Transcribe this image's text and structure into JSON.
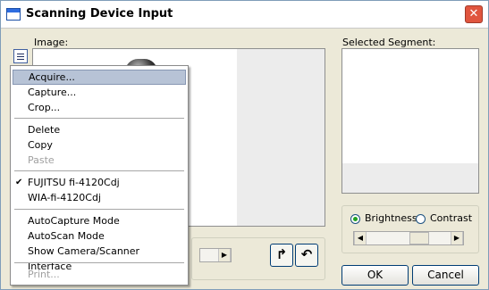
{
  "window": {
    "title": "Scanning Device Input",
    "close_glyph": "✕"
  },
  "labels": {
    "image": "Image:",
    "selected_segment": "Selected Segment:"
  },
  "adjust": {
    "brightness": "Brightness",
    "contrast": "Contrast",
    "selected": "brightness"
  },
  "buttons": {
    "ok": "OK",
    "cancel": "Cancel",
    "rotate_right_glyph": "↱",
    "rotate_left_glyph": "↶"
  },
  "menu": {
    "items": [
      {
        "label": "Acquire...",
        "state": "highlighted"
      },
      {
        "label": "Capture..."
      },
      {
        "label": "Crop..."
      },
      {
        "label": "Delete"
      },
      {
        "label": "Copy"
      },
      {
        "label": "Paste",
        "state": "disabled"
      },
      {
        "label": "FUJITSU fi-4120Cdj",
        "checked": true
      },
      {
        "label": "WIA-fi-4120Cdj"
      },
      {
        "label": "AutoCapture Mode"
      },
      {
        "label": "AutoScan Mode"
      },
      {
        "label": "Show Camera/Scanner Interface"
      },
      {
        "label": "Print...",
        "state": "disabled"
      }
    ],
    "check_glyph": "✔"
  }
}
